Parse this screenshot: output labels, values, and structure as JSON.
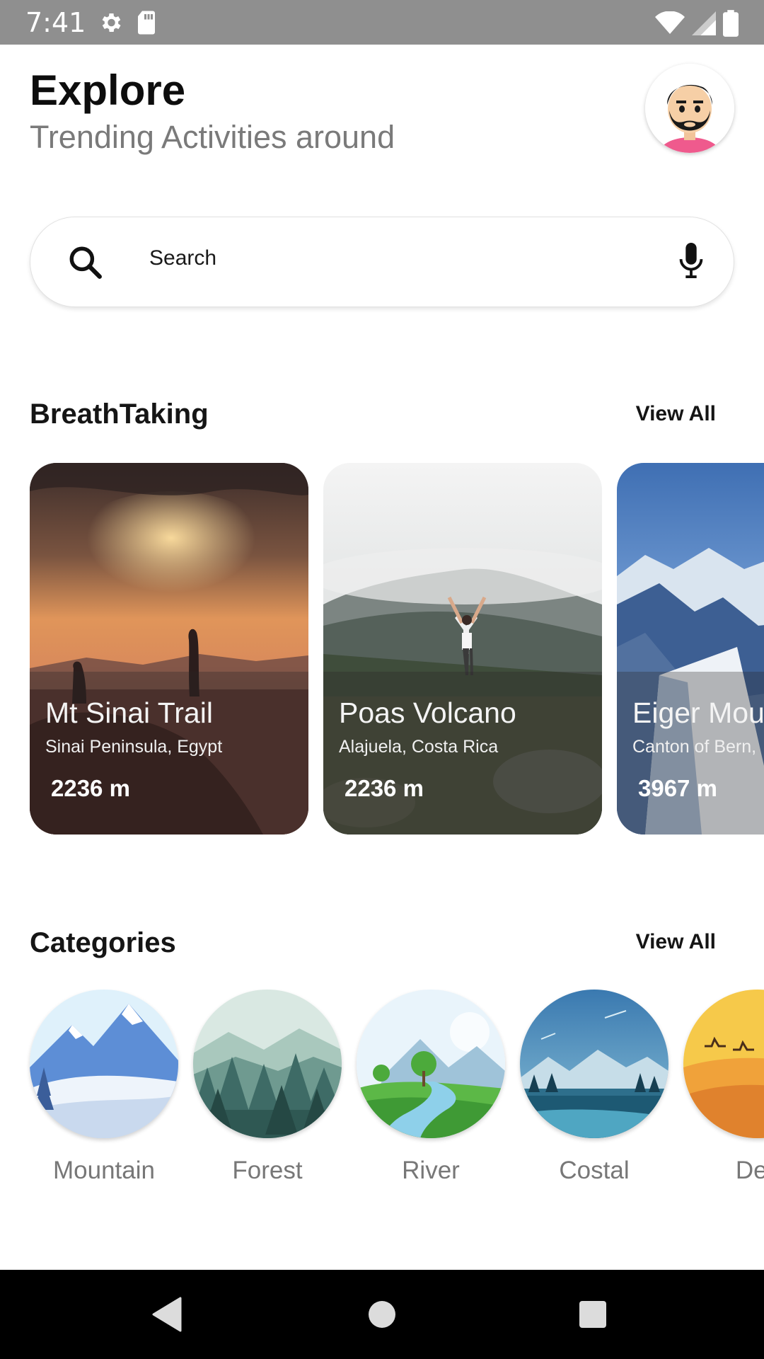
{
  "status_bar": {
    "time": "7:41",
    "left_icons": [
      "settings-icon",
      "sd-card-icon"
    ],
    "right_icons": [
      "wifi-icon",
      "signal-icon",
      "battery-icon"
    ]
  },
  "header": {
    "title": "Explore",
    "subtitle": "Trending Activities around",
    "avatar_icon": "bearded-man-avatar"
  },
  "search": {
    "label": "Search",
    "search_icon": "search-icon",
    "mic_icon": "mic-icon"
  },
  "breathtaking": {
    "title": "BreathTaking",
    "view_all": "View All",
    "cards": [
      {
        "title": "Mt Sinai Trail",
        "location": "Sinai Peninsula, Egypt",
        "elevation": "2236 m"
      },
      {
        "title": "Poas Volcano",
        "location": "Alajuela, Costa Rica",
        "elevation": "2236 m"
      },
      {
        "title": "Eiger Mou",
        "location": "Canton of Bern,",
        "elevation": "3967 m"
      }
    ]
  },
  "categories": {
    "title": "Categories",
    "view_all": "View All",
    "items": [
      {
        "label": "Mountain"
      },
      {
        "label": "Forest"
      },
      {
        "label": "River"
      },
      {
        "label": "Costal"
      },
      {
        "label": "Des"
      }
    ]
  },
  "nav_bar": {
    "buttons": [
      "back-icon",
      "home-icon",
      "recents-icon"
    ]
  }
}
